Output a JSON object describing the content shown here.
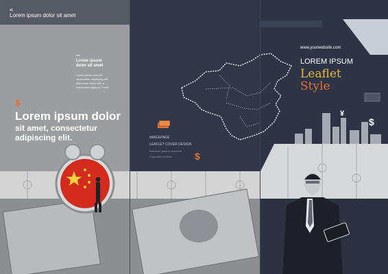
{
  "left_panel": {
    "header_small": "el.",
    "header_title": "Lorem ipsum dolor sit amet",
    "block": {
      "stars": "***",
      "title_line1": "Lorem ipsum",
      "title_line2": "dolor sit amet",
      "body_line1": "Lorem ipsum dolor sit",
      "body_line2": "consectetur adipiscing elit.",
      "body_line3": "Maecenas tellus odio a",
      "body_line4": "malesuada dapibus. Fusce"
    },
    "dollar_symbol": "$",
    "hero_line1": "Lorem ipsum dolor",
    "hero_line2": "sit amet, consectetur",
    "hero_line3": "adipiscing elit."
  },
  "middle_panel": {
    "line1": "IMAGEPAGE",
    "line2": "LEAFLET COVER DESIGN",
    "line3": "Business graphic template",
    "line4": "Copyright by Artist",
    "dollar_symbol": "$"
  },
  "right_panel": {
    "url": "www.yourwebsite.com",
    "brand_line1": "LOREM IPSUM",
    "brand_line2": "Leaflet",
    "brand_line3": "Style",
    "dollar_symbol": "$",
    "yen_symbol": "¥"
  },
  "colors": {
    "orange_accent": "#e7712e",
    "yellow_accent": "#e8b93a",
    "dark_navy": "#2c3445",
    "gray_panel": "#9c9da0"
  }
}
